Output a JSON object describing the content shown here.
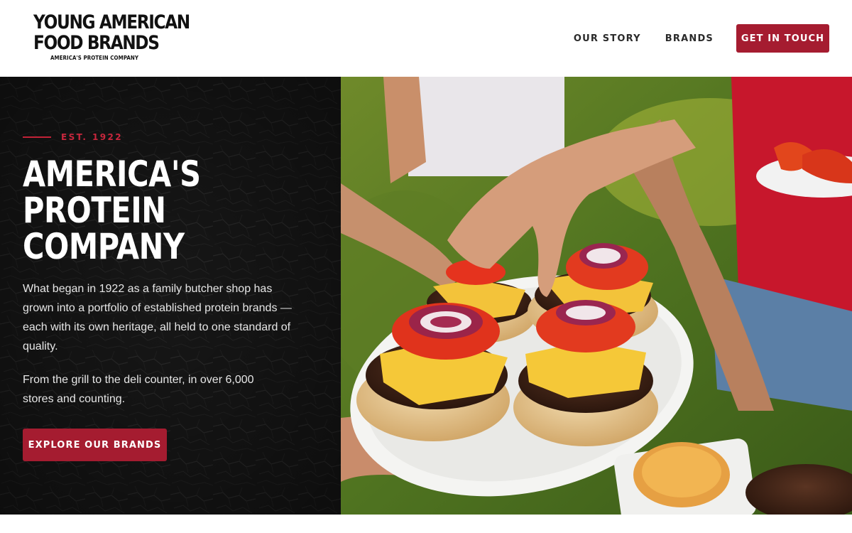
{
  "header": {
    "logo": {
      "line1": "YOUNG AMERICAN",
      "line2": "FOOD BRANDS",
      "tagline": "AMERICA'S PROTEIN COMPANY"
    },
    "nav": [
      {
        "label": "OUR STORY"
      },
      {
        "label": "BRANDS"
      }
    ],
    "cta_label": "GET IN TOUCH"
  },
  "hero": {
    "eyebrow": "EST. 1922",
    "headline": [
      "AMERICA'S",
      "PROTEIN",
      "COMPANY"
    ],
    "paragraphs": [
      "What began in 1922 as a family butcher shop has grown into a portfolio of established protein brands — each with its own heritage, all held to one standard of quality.",
      "From the grill to the deli counter, in over 6,000 stores and counting."
    ],
    "cta_label": "EXPLORE OUR BRANDS",
    "image": {
      "subject": "burgers-on-plate"
    }
  },
  "colors": {
    "accent": "#a51c30",
    "hero_left_bg": "#151515",
    "header_bg": "#ffffff"
  }
}
